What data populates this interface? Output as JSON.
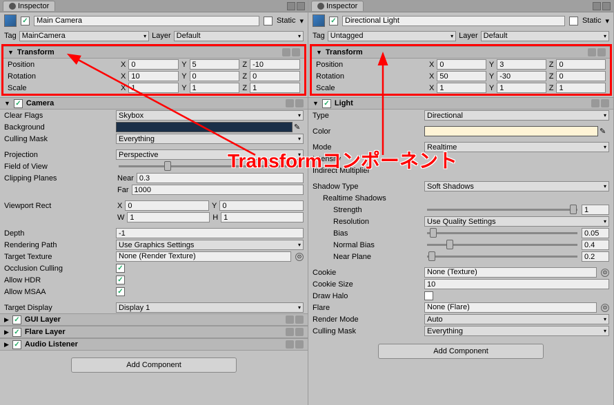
{
  "left": {
    "tab_title": "Inspector",
    "go_name": "Main Camera",
    "static_label": "Static",
    "tag_label": "Tag",
    "tag_value": "MainCamera",
    "layer_label": "Layer",
    "layer_value": "Default",
    "transform": {
      "title": "Transform",
      "position_label": "Position",
      "rotation_label": "Rotation",
      "scale_label": "Scale",
      "pos": {
        "x": "0",
        "y": "5",
        "z": "-10"
      },
      "rot": {
        "x": "10",
        "y": "0",
        "z": "0"
      },
      "scale": {
        "x": "1",
        "y": "1",
        "z": "1"
      }
    },
    "camera": {
      "title": "Camera",
      "clear_flags_label": "Clear Flags",
      "clear_flags_value": "Skybox",
      "background_label": "Background",
      "culling_mask_label": "Culling Mask",
      "culling_mask_value": "Everything",
      "projection_label": "Projection",
      "projection_value": "Perspective",
      "fov_label": "Field of View",
      "clipping_label": "Clipping Planes",
      "near_label": "Near",
      "near_value": "0.3",
      "far_label": "Far",
      "far_value": "1000",
      "viewport_label": "Viewport Rect",
      "vp_x": "0",
      "vp_y": "0",
      "vp_w": "1",
      "vp_h": "1",
      "depth_label": "Depth",
      "depth_value": "-1",
      "rendering_path_label": "Rendering Path",
      "rendering_path_value": "Use Graphics Settings",
      "target_texture_label": "Target Texture",
      "target_texture_value": "None (Render Texture)",
      "occlusion_label": "Occlusion Culling",
      "hdr_label": "Allow HDR",
      "msaa_label": "Allow MSAA",
      "target_display_label": "Target Display",
      "target_display_value": "Display 1"
    },
    "comps": {
      "gui_layer": "GUI Layer",
      "flare_layer": "Flare Layer",
      "audio_listener": "Audio Listener"
    },
    "add_component": "Add Component"
  },
  "right": {
    "tab_title": "Inspector",
    "go_name": "Directional Light",
    "static_label": "Static",
    "tag_label": "Tag",
    "tag_value": "Untagged",
    "layer_label": "Layer",
    "layer_value": "Default",
    "transform": {
      "title": "Transform",
      "position_label": "Position",
      "rotation_label": "Rotation",
      "scale_label": "Scale",
      "pos": {
        "x": "0",
        "y": "3",
        "z": "0"
      },
      "rot": {
        "x": "50",
        "y": "-30",
        "z": "0"
      },
      "scale": {
        "x": "1",
        "y": "1",
        "z": "1"
      }
    },
    "light": {
      "title": "Light",
      "type_label": "Type",
      "type_value": "Directional",
      "color_label": "Color",
      "mode_label": "Mode",
      "mode_value": "Realtime",
      "intensity_label": "Intensity",
      "indirect_label": "Indirect Multiplier",
      "shadow_type_label": "Shadow Type",
      "shadow_type_value": "Soft Shadows",
      "realtime_shadows_label": "Realtime Shadows",
      "strength_label": "Strength",
      "strength_value": "1",
      "resolution_label": "Resolution",
      "resolution_value": "Use Quality Settings",
      "bias_label": "Bias",
      "bias_value": "0.05",
      "normal_bias_label": "Normal Bias",
      "normal_bias_value": "0.4",
      "near_plane_label": "Near Plane",
      "near_plane_value": "0.2",
      "cookie_label": "Cookie",
      "cookie_value": "None (Texture)",
      "cookie_size_label": "Cookie Size",
      "cookie_size_value": "10",
      "draw_halo_label": "Draw Halo",
      "flare_label": "Flare",
      "flare_value": "None (Flare)",
      "render_mode_label": "Render Mode",
      "render_mode_value": "Auto",
      "culling_mask_label": "Culling Mask",
      "culling_mask_value": "Everything"
    },
    "add_component": "Add Component"
  },
  "axis": {
    "x": "X",
    "y": "Y",
    "z": "Z",
    "w": "W",
    "h": "H"
  },
  "annotation_text": "Transformコンポーネント"
}
